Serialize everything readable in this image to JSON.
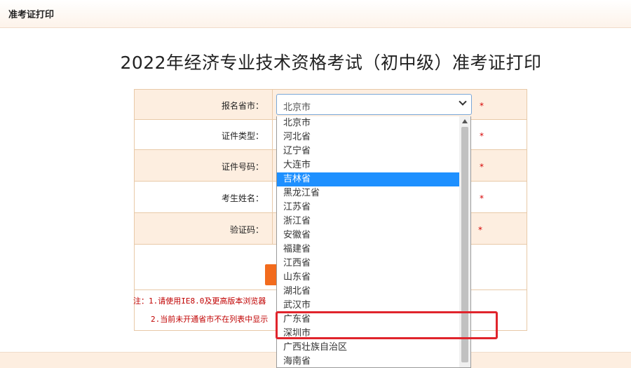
{
  "header": {
    "title": "准考证打印"
  },
  "page_title": "2022年经济专业技术资格考试（初中级）准考证打印",
  "form": {
    "rows": [
      {
        "label": "报名省市：",
        "required": "*"
      },
      {
        "label": "证件类型：",
        "required": "*"
      },
      {
        "label": "证件号码：",
        "required": "*"
      },
      {
        "label": "考生姓名：",
        "required": "*"
      },
      {
        "label": "验证码：",
        "required": "*"
      }
    ],
    "province_select": {
      "value": "北京市"
    }
  },
  "notes": [
    "注：1.请使用IE8.0及更高版本浏览器",
    "2.当前未开通省市不在列表中显示"
  ],
  "dropdown": {
    "options": [
      "北京市",
      "河北省",
      "辽宁省",
      "大连市",
      "吉林省",
      "黑龙江省",
      "江苏省",
      "浙江省",
      "安徽省",
      "福建省",
      "江西省",
      "山东省",
      "湖北省",
      "武汉市",
      "广东省",
      "深圳市",
      "广西壮族自治区",
      "海南省"
    ],
    "selected": "吉林省"
  },
  "colors": {
    "accent": "#f26b1d",
    "highlight": "#e0242c",
    "selected": "#1e90ff",
    "required": "#d60000"
  }
}
